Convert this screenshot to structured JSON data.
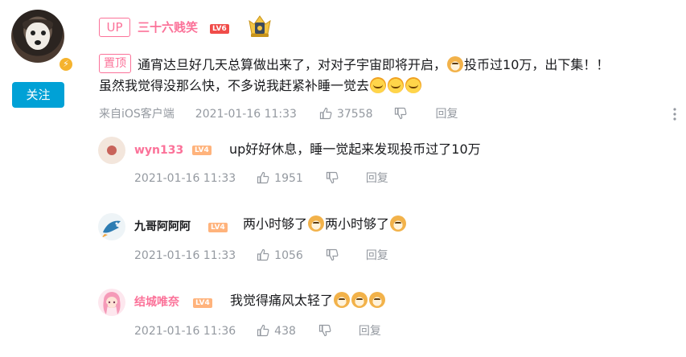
{
  "main_comment": {
    "author": "三十六贱笑",
    "up_tag": "UP",
    "level": "LV6",
    "pin_tag": "置顶",
    "text_line1_a": "通宵达旦好几天总算做出来了，对对子宇宙即将开启，",
    "text_line1_b": "投币过10万，出下集！！",
    "text_line2": "虽然我觉得没那么快，不多说我赶紧补睡一觉去",
    "source": "来自iOS客户端",
    "time": "2021-01-16 11:33",
    "likes": "37558",
    "reply_label": "回复",
    "follow_label": "关注"
  },
  "replies": [
    {
      "author": "wyn133",
      "level": "LV4",
      "text": "up好好休息，睡一觉起来发现投币过了10万",
      "time": "2021-01-16 11:33",
      "likes": "1951",
      "reply_label": "回复"
    },
    {
      "author": "九哥阿阿阿",
      "level": "LV4",
      "text_a": "两小时够了",
      "text_b": "两小时够了",
      "time": "2021-01-16 11:33",
      "likes": "1056",
      "reply_label": "回复"
    },
    {
      "author": "结城唯奈",
      "level": "LV4",
      "text": "我觉得痛风太轻了",
      "time": "2021-01-16 11:36",
      "likes": "438",
      "reply_label": "回复"
    }
  ],
  "colors": {
    "accent_pink": "#fb7299",
    "follow_blue": "#00a1d6",
    "meta_gray": "#9499a0",
    "lv6_red": "#f04c49",
    "lv4_orange": "#ffb37c"
  },
  "icons": {
    "like": "thumb-up-icon",
    "dislike": "thumb-down-icon",
    "more": "more-vertical-icon",
    "vip": "vip-lightning-icon",
    "emoji_doge": "doge-emoji-icon",
    "emoji_sleep": "sleep-emoji-icon",
    "crown": "crown-badge-icon"
  }
}
